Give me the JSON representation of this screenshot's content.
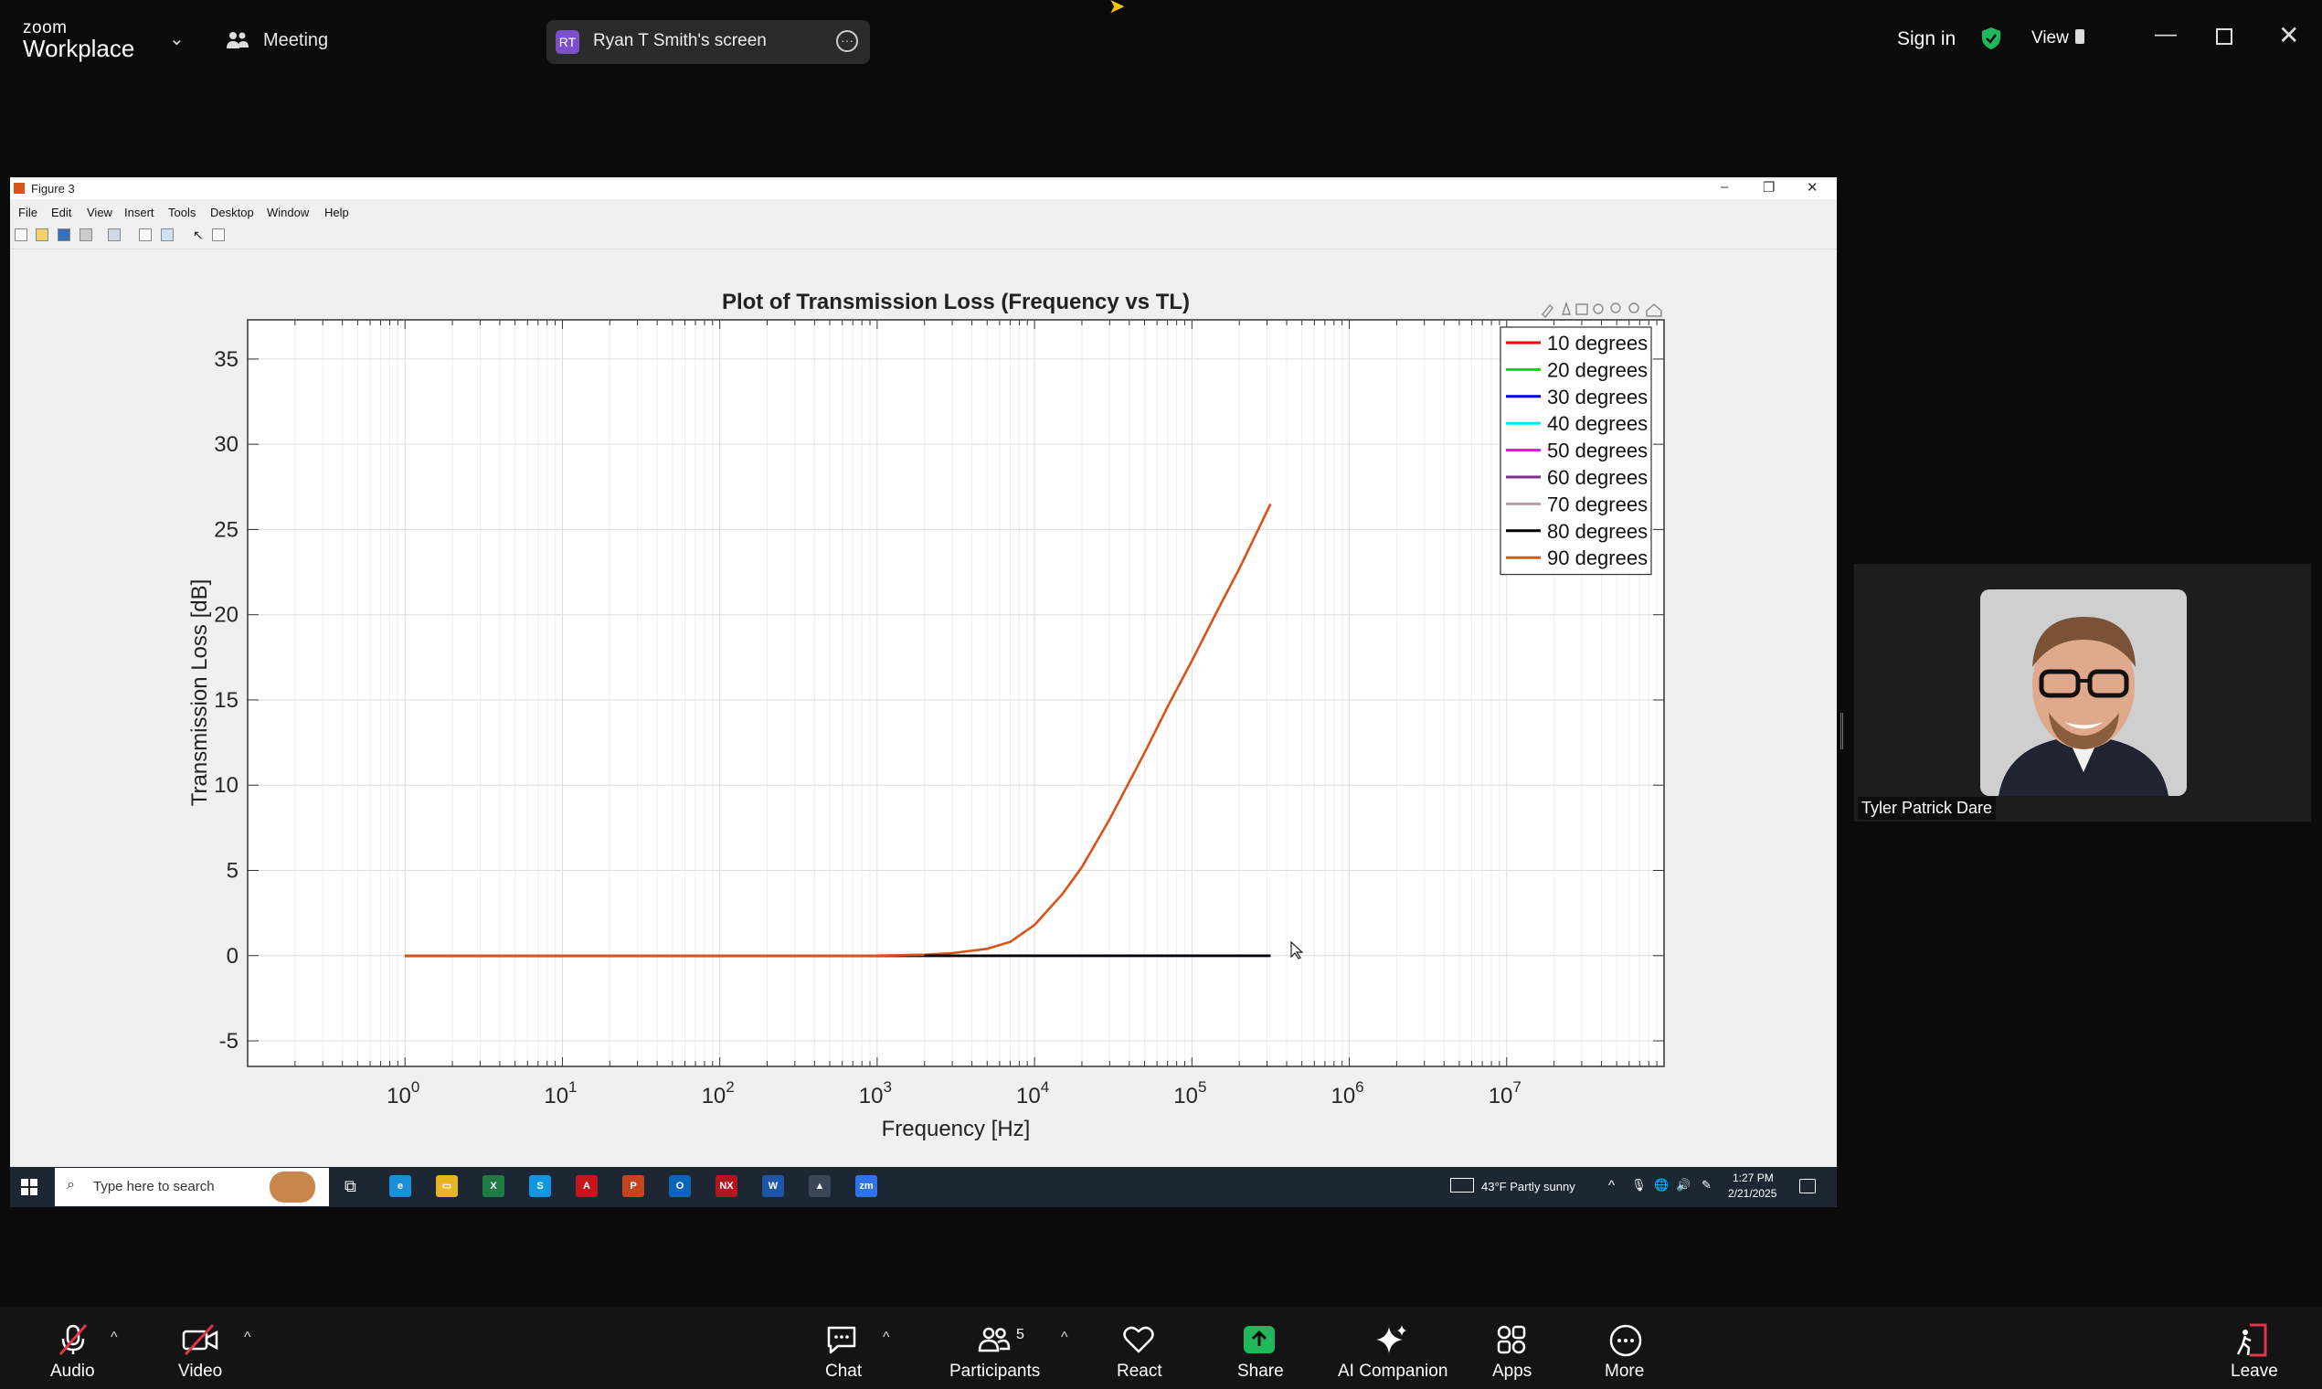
{
  "zoom": {
    "brand_small": "zoom",
    "brand_big": "Workplace",
    "meeting_label": "Meeting",
    "share_badge": "RT",
    "share_label": "Ryan T Smith's screen",
    "sign_in": "Sign in",
    "view_label": "View",
    "participant_name": "Tyler Patrick Dare",
    "toolbar": {
      "audio": "Audio",
      "video": "Video",
      "chat": "Chat",
      "participants": "Participants",
      "participants_count": "5",
      "react": "React",
      "share": "Share",
      "ai_companion": "AI Companion",
      "apps": "Apps",
      "more": "More",
      "leave": "Leave"
    },
    "colors": {
      "share_green": "#1fb85a",
      "leave_red": "#e0354b",
      "shield_green": "#1fb85a"
    }
  },
  "matlab": {
    "window_title": "Figure 3",
    "menu": [
      "File",
      "Edit",
      "View",
      "Insert",
      "Tools",
      "Desktop",
      "Window",
      "Help"
    ]
  },
  "taskbar": {
    "search_placeholder": "Type here to search",
    "apps": [
      {
        "name": "Edge",
        "color": "#1a8fd8",
        "glyph": "e"
      },
      {
        "name": "Explorer",
        "color": "#e8b423",
        "glyph": "▭"
      },
      {
        "name": "Excel",
        "color": "#1f7a44",
        "glyph": "X"
      },
      {
        "name": "Skype",
        "color": "#1196e0",
        "glyph": "S"
      },
      {
        "name": "Acrobat",
        "color": "#c4161c",
        "glyph": "A"
      },
      {
        "name": "PowerPoint",
        "color": "#c4441d",
        "glyph": "P"
      },
      {
        "name": "Outlook",
        "color": "#0c64b8",
        "glyph": "O"
      },
      {
        "name": "NX",
        "color": "#b3151f",
        "glyph": "NX"
      },
      {
        "name": "Word",
        "color": "#1f56a8",
        "glyph": "W"
      },
      {
        "name": "MATLAB",
        "color": "#3a4656",
        "glyph": "▲"
      },
      {
        "name": "Zoom",
        "color": "#2d74e8",
        "glyph": "zm"
      }
    ],
    "weather": "43°F  Partly sunny",
    "time": "1:27 PM",
    "date": "2/21/2025"
  },
  "chart_data": {
    "type": "line",
    "title": "Plot of Transmission Loss (Frequency vs TL)",
    "xlabel": "Frequency [Hz]",
    "ylabel": "Transmission Loss [dB]",
    "xscale": "log",
    "xlim": [
      0.1,
      100000000
    ],
    "ylim": [
      -6.5,
      37.3
    ],
    "xticks": [
      {
        "exp": "0",
        "value": 1
      },
      {
        "exp": "1",
        "value": 10
      },
      {
        "exp": "2",
        "value": 100
      },
      {
        "exp": "3",
        "value": 1000
      },
      {
        "exp": "4",
        "value": 10000
      },
      {
        "exp": "5",
        "value": 100000
      },
      {
        "exp": "6",
        "value": 1000000
      },
      {
        "exp": "7",
        "value": 10000000
      }
    ],
    "yticks": [
      "-5",
      "0",
      "5",
      "10",
      "15",
      "20",
      "25",
      "30",
      "35"
    ],
    "grid": true,
    "legend_position": "top-right",
    "series": [
      {
        "name": "10 degrees",
        "color": "#ff0000",
        "x": [
          1,
          316000
        ],
        "y": [
          0,
          0
        ]
      },
      {
        "name": "20 degrees",
        "color": "#00e000",
        "x": [
          1,
          316000
        ],
        "y": [
          0,
          0
        ]
      },
      {
        "name": "30 degrees",
        "color": "#0000ff",
        "x": [
          1,
          316000
        ],
        "y": [
          0,
          0
        ]
      },
      {
        "name": "40 degrees",
        "color": "#00e5ff",
        "x": [
          1,
          316000
        ],
        "y": [
          0,
          0
        ]
      },
      {
        "name": "50 degrees",
        "color": "#ff00ff",
        "x": [
          1,
          316000
        ],
        "y": [
          0,
          0
        ]
      },
      {
        "name": "60 degrees",
        "color": "#7e2f8e",
        "x": [
          1,
          316000
        ],
        "y": [
          0,
          0
        ]
      },
      {
        "name": "70 degrees",
        "color": "#b0a0a0",
        "x": [
          1,
          316000
        ],
        "y": [
          0,
          0
        ]
      },
      {
        "name": "80 degrees",
        "color": "#000000",
        "x": [
          1,
          316000
        ],
        "y": [
          0,
          0
        ]
      },
      {
        "name": "90 degrees",
        "color": "#d95319",
        "x": [
          1,
          10,
          100,
          1000,
          2000,
          3000,
          5000,
          7000,
          10000,
          15000,
          20000,
          30000,
          50000,
          70000,
          100000,
          150000,
          200000,
          316000
        ],
        "y": [
          0,
          0,
          0,
          0,
          0.05,
          0.15,
          0.4,
          0.8,
          1.8,
          3.6,
          5.2,
          8.0,
          11.9,
          14.6,
          17.3,
          20.5,
          22.7,
          26.5
        ]
      }
    ]
  }
}
